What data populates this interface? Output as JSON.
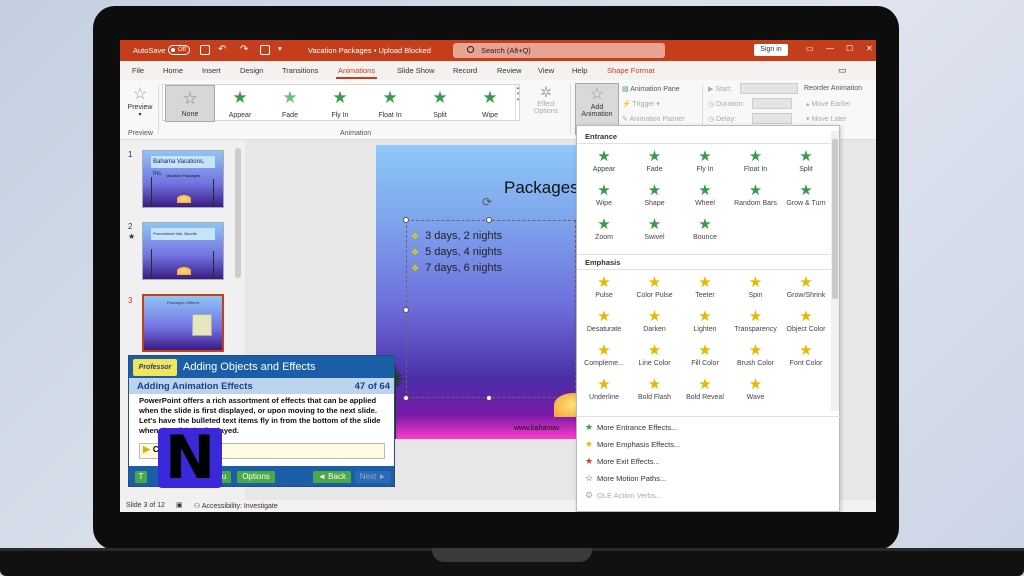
{
  "window": {
    "autosave_label": "AutoSave",
    "autosave_state": "Off",
    "doc_title": "Vacation Packages • Upload Blocked",
    "search_placeholder": "Search (Alt+Q)",
    "signin_label": "Sign in",
    "accent": "#c43e1c"
  },
  "tabs": [
    "File",
    "Home",
    "Insert",
    "Design",
    "Transitions",
    "Animations",
    "Slide Show",
    "Record",
    "Review",
    "View",
    "Help",
    "Shape Format"
  ],
  "ribbon": {
    "preview_label": "Preview",
    "preview_group": "Preview",
    "animation_group": "Animation",
    "gallery": [
      "None",
      "Appear",
      "Fade",
      "Fly In",
      "Float In",
      "Split",
      "Wipe"
    ],
    "effect_options": "Effect Options",
    "add_animation": "Add Animation",
    "animation_pane": "Animation Pane",
    "trigger": "Trigger",
    "animation_painter": "Animation Painter",
    "start": "Start:",
    "duration": "Duration:",
    "delay": "Delay:",
    "reorder": "Reorder Animation",
    "move_earlier": "Move Earlier",
    "move_later": "Move Later"
  },
  "thumbnails": [
    {
      "num": "1",
      "title": "Bahama Vacations, Inc.",
      "sub": "Vacation Packages"
    },
    {
      "num": "2",
      "title": "Promotional Info. Bundle",
      "sub": ""
    },
    {
      "num": "3",
      "title": "Packages Offered",
      "sub": ""
    }
  ],
  "slide": {
    "title": "Packages",
    "bullets": [
      "3 days, 2 nights",
      "5 days, 4 nights",
      "7 days, 6 nights"
    ],
    "footer_text": "www.bahamav"
  },
  "tutorial": {
    "logo": "Professor",
    "header": "Adding Objects and Effects",
    "subtitle": "Adding Animation Effects",
    "page": "47 of 64",
    "body": "PowerPoint offers a rich assortment of effects that can be applied when the slide is first displayed, or upon moving to the next slide. Let's have the bulleted text items fly in from the bottom of the slide when the slide is displayed.",
    "play_text": "Cl",
    "btn_t": "T",
    "btn_u": "u",
    "btn_options": "Options",
    "btn_back": "◄ Back",
    "btn_next": "Next ►"
  },
  "overlay_logo": "N",
  "dropdown": {
    "entrance_head": "Entrance",
    "entrance": [
      "Appear",
      "Fade",
      "Fly In",
      "Float In",
      "Split",
      "Wipe",
      "Shape",
      "Wheel",
      "Random Bars",
      "Grow & Turn",
      "Zoom",
      "Swivel",
      "Bounce"
    ],
    "emphasis_head": "Emphasis",
    "emphasis": [
      "Pulse",
      "Color Pulse",
      "Teeter",
      "Spin",
      "Grow/Shrink",
      "Desaturate",
      "Darken",
      "Lighten",
      "Transparency",
      "Object Color",
      "Compleme...",
      "Line Color",
      "Fill Color",
      "Brush Color",
      "Font Color",
      "Underline",
      "Bold Flash",
      "Bold Reveal",
      "Wave"
    ],
    "more": [
      "More Entrance Effects...",
      "More Emphasis Effects...",
      "More Exit Effects...",
      "More Motion Paths...",
      "OLE Action Verbs..."
    ]
  },
  "status": {
    "slide_of": "Slide 3 of 12",
    "accessibility": "Accessibility: Investigate"
  }
}
